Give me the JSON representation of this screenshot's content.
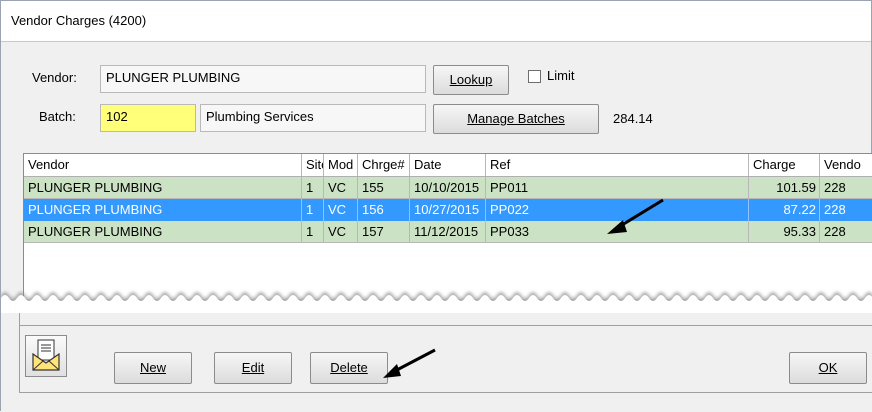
{
  "window": {
    "title": "Vendor Charges (4200)"
  },
  "form": {
    "vendor_label": "Vendor:",
    "vendor_value": "PLUNGER PLUMBING",
    "lookup_label": "Lookup",
    "limit_label": "Limit",
    "batch_label": "Batch:",
    "batch_number": "102",
    "batch_name": "Plumbing Services",
    "manage_batches_label": "Manage Batches",
    "batch_total": "284.14"
  },
  "grid": {
    "columns": [
      "Vendor",
      "Site",
      "Mod",
      "Chrge#",
      "Date",
      "Ref",
      "Charge",
      "Vendo"
    ],
    "rows": [
      [
        "PLUNGER PLUMBING",
        "1",
        "VC",
        "155",
        "10/10/2015",
        "PP011",
        "101.59",
        "228"
      ],
      [
        "PLUNGER PLUMBING",
        "1",
        "VC",
        "156",
        "10/27/2015",
        "PP022",
        "87.22",
        "228"
      ],
      [
        "PLUNGER PLUMBING",
        "1",
        "VC",
        "157",
        "11/12/2015",
        "PP033",
        "95.33",
        "228"
      ]
    ],
    "selected_row": 1
  },
  "footer": {
    "new_label": "New",
    "edit_label": "Edit",
    "delete_label": "Delete",
    "ok_label": "OK"
  },
  "icons": {
    "mail": "envelope-document-icon",
    "arrow": "callout-arrow-icon"
  },
  "colors": {
    "row_green": "#cbe3c4",
    "row_selected": "#3399ff",
    "batch_field": "#ffff7a"
  }
}
